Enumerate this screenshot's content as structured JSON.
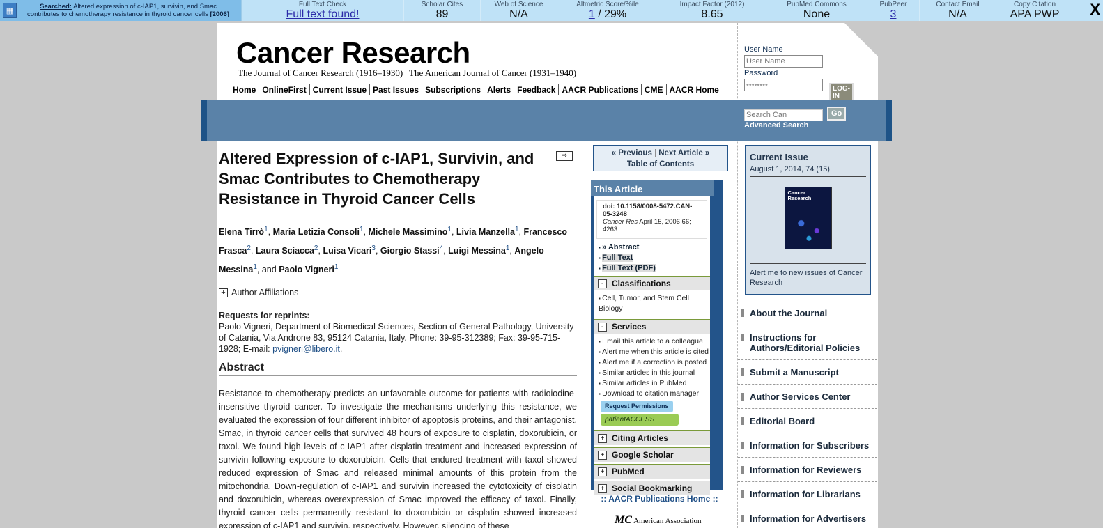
{
  "toolbar": {
    "searched_label": "Searched:",
    "searched_text": "Altered expression of c-IAP1, survivin, and Smac contributes to chemotherapy resistance in thyroid cancer cells",
    "searched_year": "[2006]",
    "cells": [
      {
        "header": "Full Text Check",
        "value": "Full text found!"
      },
      {
        "header": "Scholar Cites",
        "value": "89"
      },
      {
        "header": "Web of Science",
        "value": "N/A"
      },
      {
        "header": "Altmetric Score/%ile",
        "value_link": "1",
        "value_rest": " / 29%"
      },
      {
        "header": "Impact Factor (2012)",
        "value": "8.65"
      },
      {
        "header": "PubMed Commons",
        "value": "None"
      },
      {
        "header": "PubPeer",
        "value": "3"
      },
      {
        "header": "Contact Email",
        "value": "N/A"
      },
      {
        "header": "Copy Citation",
        "value": "APA PWP"
      }
    ],
    "close": "X"
  },
  "header": {
    "logo": "Cancer Research",
    "tagline": "The Journal of Cancer Research (1916–1930) | The American Journal of Cancer (1931–1940)",
    "nav": [
      "Home",
      "OnlineFirst",
      "Current Issue",
      "Past Issues",
      "Subscriptions",
      "Alerts",
      "Feedback",
      "AACR Publications",
      "CME",
      "AACR Home"
    ]
  },
  "login": {
    "username_label": "User Name",
    "username_placeholder": "User Name",
    "password_label": "Password",
    "password_value": "••••••••",
    "login_button": "LOG-IN"
  },
  "search": {
    "placeholder": "Search Can",
    "go": "Go",
    "advanced": "Advanced Search"
  },
  "article": {
    "title": "Altered Expression of c-IAP1, Survivin, and Smac Contributes to Chemotherapy Resistance in Thyroid Cancer Cells",
    "arrow": "⇨",
    "authors": [
      {
        "name": "Elena Tirrò",
        "sup": "1"
      },
      {
        "name": "Maria Letizia Consoli",
        "sup": "1"
      },
      {
        "name": "Michele Massimino",
        "sup": "1"
      },
      {
        "name": "Livia Manzella",
        "sup": "1"
      },
      {
        "name": "Francesco Frasca",
        "sup": "2"
      },
      {
        "name": "Laura Sciacca",
        "sup": "2"
      },
      {
        "name": "Luisa Vicari",
        "sup": "3"
      },
      {
        "name": "Giorgio Stassi",
        "sup": "4"
      },
      {
        "name": "Luigi Messina",
        "sup": "1"
      },
      {
        "name": "Angelo Messina",
        "sup": "1"
      },
      {
        "name": "Paolo Vigneri",
        "sup": "1"
      }
    ],
    "and_word": ", and ",
    "affiliations_label": "Author Affiliations",
    "reprints_label": "Requests for reprints:",
    "reprints_text": "Paolo Vigneri, Department of Biomedical Sciences, Section of General Pathology, University of Catania, Via Androne 83, 95124 Catania, Italy. Phone: 39-95-312389; Fax: 39-95-715-1928; E-mail: ",
    "reprints_email": "pvigneri@libero.it",
    "reprints_end": ".",
    "abstract_heading": "Abstract",
    "abstract": "Resistance to chemotherapy predicts an unfavorable outcome for patients with radioiodine-insensitive thyroid cancer. To investigate the mechanisms underlying this resistance, we evaluated the expression of four different inhibitor of apoptosis proteins, and their antagonist, Smac, in thyroid cancer cells that survived 48 hours of exposure to cisplatin, doxorubicin, or taxol. We found high levels of c-IAP1 after cisplatin treatment and increased expression of survivin following exposure to doxorubicin. Cells that endured treatment with taxol showed reduced expression of Smac and released minimal amounts of this protein from the mitochondria. Down-regulation of c-IAP1 and survivin increased the cytotoxicity of cisplatin and doxorubicin, whereas overexpression of Smac improved the efficacy of taxol. Finally, thyroid cancer cells permanently resistant to doxorubicin or cisplatin showed increased expression of c-IAP1 and survivin, respectively. However, silencing of these"
  },
  "middle": {
    "previous": "« Previous",
    "sep": " | ",
    "next": "Next Article »",
    "toc": "Table of Contents",
    "this_article": "This Article",
    "doi_label": "doi:",
    "doi": "10.1158/0008-5472.CAN-05-3248",
    "citation_journal": "Cancer Res",
    "citation_rest": " April 15, 2006 66; 4263",
    "links": [
      "» Abstract",
      "Full Text",
      "Full Text (PDF)"
    ],
    "classifications": "Classifications",
    "classification_item": "Cell, Tumor, and Stem Cell Biology",
    "services": "Services",
    "service_items": [
      "Email this article to a colleague",
      "Alert me when this article is cited",
      "Alert me if a correction is posted",
      "Similar articles in this journal",
      "Similar articles in PubMed",
      "Download to citation manager"
    ],
    "request_permissions": "Request Permissions",
    "patient_access": "patientACCESS",
    "citing": "Citing Articles",
    "scholar": "Google Scholar",
    "pubmed": "PubMed",
    "social": "Social Bookmarking",
    "minus": "-",
    "plus": "+",
    "aacr_home": ":: AACR Publications Home ::",
    "aacr_logo": "American Association"
  },
  "right": {
    "current_issue": "Current Issue",
    "date": "August 1, 2014, 74 (15)",
    "cover_title": "Cancer Research",
    "alert": "Alert me to new issues of Cancer Research",
    "links": [
      "About the Journal",
      "Instructions for Authors/Editorial Policies",
      "Submit a Manuscript",
      "Author Services Center",
      "Editorial Board",
      "Information for Subscribers",
      "Information for Reviewers",
      "Information for Librarians",
      "Information for Advertisers"
    ]
  }
}
